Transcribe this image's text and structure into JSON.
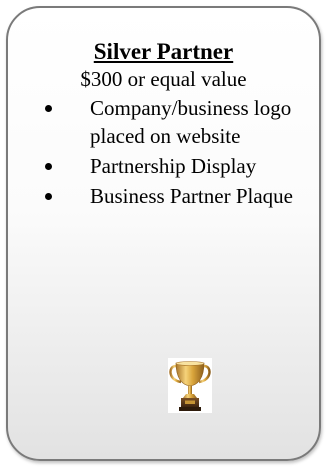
{
  "card": {
    "title": "Silver Partner",
    "price": "$300 or equal value",
    "benefits": [
      {
        "text": "Company/business logo placed on website"
      },
      {
        "text": "Partnership Display"
      },
      {
        "text": "Business Partner Plaque"
      }
    ],
    "icon": "trophy-icon",
    "colors": {
      "border": "#7a7a7a",
      "trophy_gold": "#d9a43b",
      "trophy_base": "#5a3a1a"
    }
  }
}
